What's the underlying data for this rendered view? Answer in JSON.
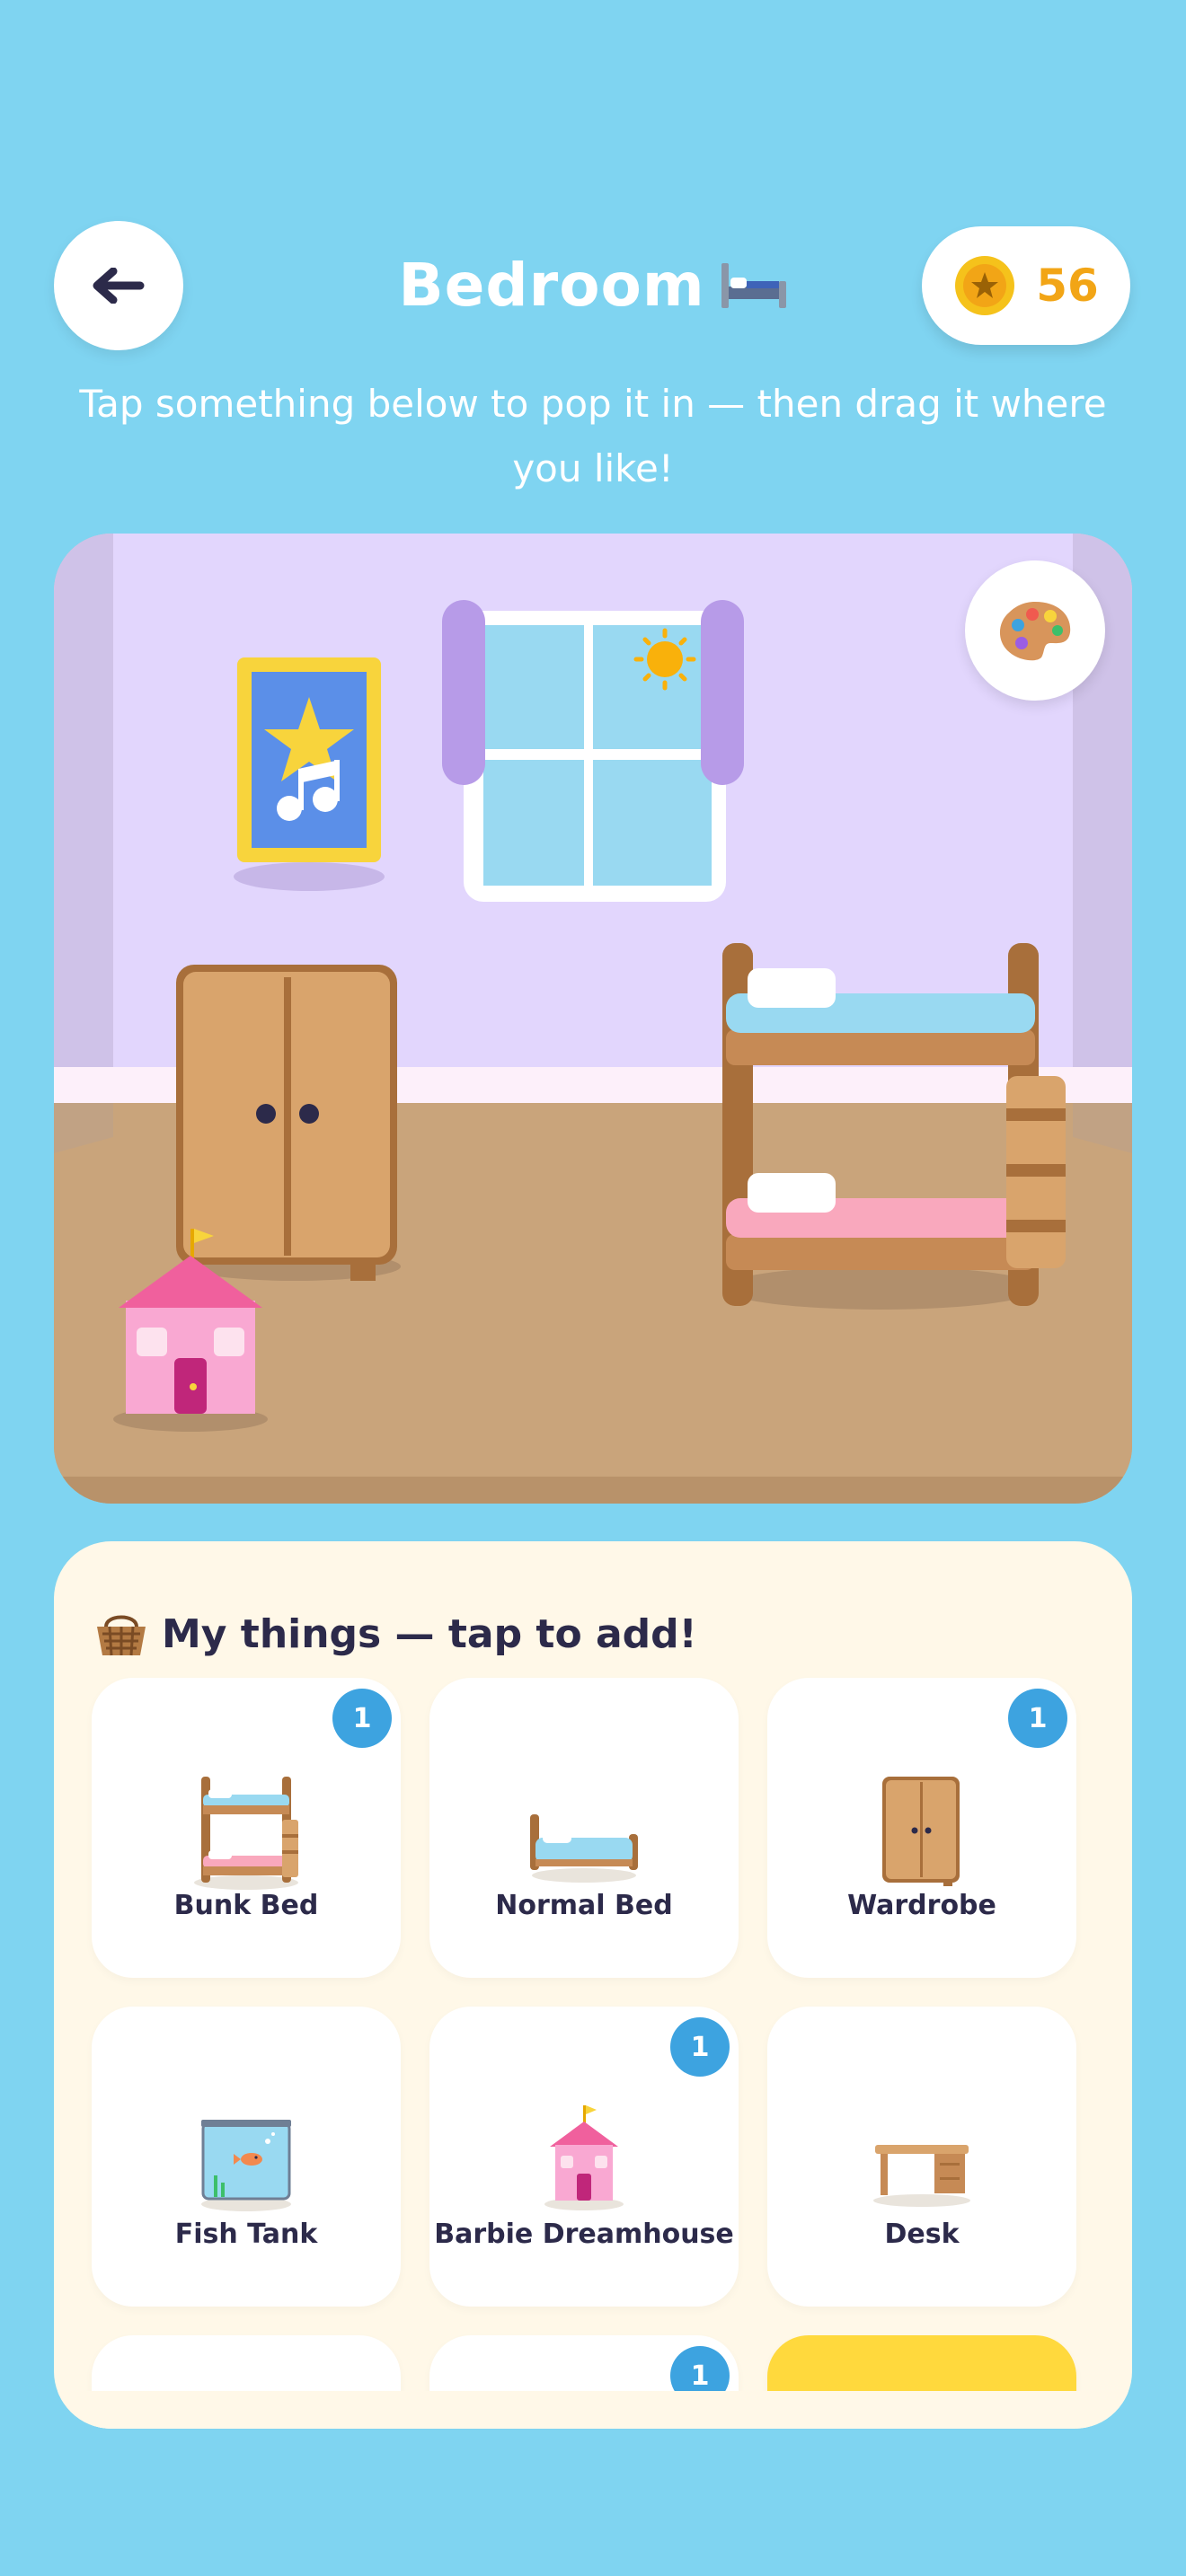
{
  "header": {
    "title": "Bedroom",
    "title_emoji": "🛏️",
    "coins": "56"
  },
  "subtitle": "Tap something below to pop it in — then drag it where you like!",
  "room": {
    "wall_color": "#e2d6fd",
    "floor_color": "#c9a47b",
    "trim_color": "#fdf0fa"
  },
  "panel": {
    "title": "My things — tap to add!",
    "items": [
      {
        "label": "Bunk Bed",
        "badge": "1"
      },
      {
        "label": "Normal Bed",
        "badge": ""
      },
      {
        "label": "Wardrobe",
        "badge": "1"
      },
      {
        "label": "Fish Tank",
        "badge": ""
      },
      {
        "label": "Barbie Dreamhouse",
        "badge": "1"
      },
      {
        "label": "Desk",
        "badge": ""
      },
      {
        "label": "",
        "badge": ""
      },
      {
        "label": "",
        "badge": "1"
      },
      {
        "label": "",
        "badge": ""
      }
    ]
  },
  "colors": {
    "background": "#7fd4f1",
    "accent_coin": "#f2a516",
    "badge": "#3da3e0",
    "panel": "#fff8e8",
    "highlight_card": "#ffd93d"
  }
}
